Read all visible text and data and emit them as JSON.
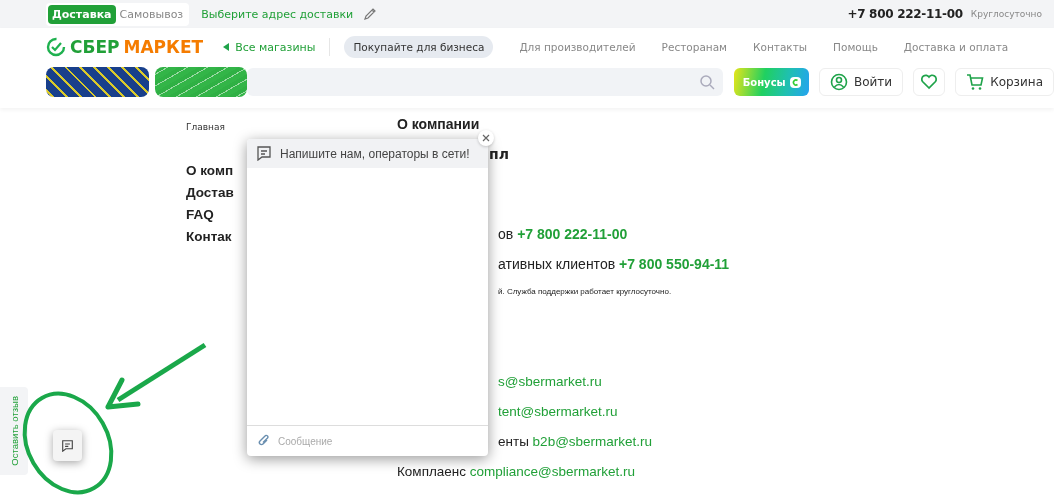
{
  "topbar": {
    "mode_tabs": [
      {
        "label": "Доставка",
        "selected": true
      },
      {
        "label": "Самовывоз",
        "selected": false
      }
    ],
    "address_link": "Выберите адрес доставки",
    "phone": "+7 800 222-11-00",
    "hours": "Круглосуточно"
  },
  "header": {
    "logo": {
      "word_1": "СБЕР",
      "word_2": "МАРКЕТ"
    },
    "all_stores": "Все магазины",
    "nav": [
      {
        "label": "Покупайте для бизнеса",
        "selected": true
      },
      {
        "label": "Для производителей",
        "selected": false
      },
      {
        "label": "Ресторанам",
        "selected": false
      },
      {
        "label": "Контакты",
        "selected": false
      },
      {
        "label": "Помощь",
        "selected": false
      },
      {
        "label": "Доставка и оплата",
        "selected": false
      }
    ],
    "bonus_button": "Бонусы",
    "login_button": "Войти",
    "cart_button": "Корзина"
  },
  "breadcrumb": "Главная",
  "page_title": "О компании",
  "sidebar_links": [
    "О комп",
    "Достав",
    "FAQ",
    "Контак"
  ],
  "content": {
    "subtitle_fragment": "пл",
    "lines": [
      {
        "kind": "cut",
        "text": "ов ",
        "link": "+7 800 222-11-00",
        "large": true
      },
      {
        "kind": "cut",
        "text": "ативных клиентов ",
        "link": "+7 800 550-94-11",
        "large": true
      },
      {
        "kind": "note",
        "text": "й. Служба поддержки работает круглосуточно."
      },
      {
        "kind": "gap"
      },
      {
        "kind": "cut",
        "link": "s@sbermarket.ru",
        "large": false
      },
      {
        "kind": "cut",
        "link": "tent@sbermarket.ru",
        "large": false
      },
      {
        "kind": "cut",
        "text": "енты ",
        "link": "b2b@sbermarket.ru",
        "large": false
      },
      {
        "kind": "full",
        "text": "Комплаенс ",
        "link": "compliance@sbermarket.ru",
        "large": false
      }
    ]
  },
  "chat": {
    "header": "Напишите нам, операторы в сети!",
    "message_placeholder": "Сообщение"
  },
  "feedback_tab": "Оставить отзыв"
}
